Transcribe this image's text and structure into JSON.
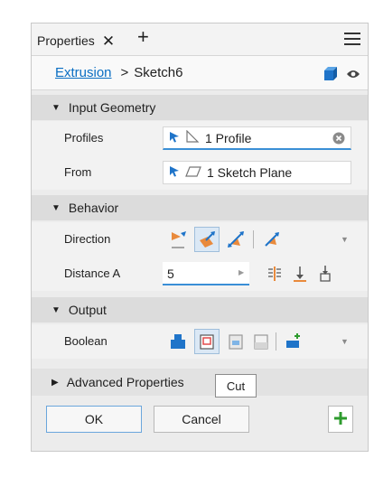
{
  "tab": {
    "title": "Properties"
  },
  "breadcrumb": {
    "parent": "Extrusion",
    "separator": ">",
    "current": "Sketch6"
  },
  "sections": {
    "input_geometry": {
      "title": "Input Geometry"
    },
    "behavior": {
      "title": "Behavior"
    },
    "output": {
      "title": "Output"
    },
    "advanced": {
      "title": "Advanced Properties"
    }
  },
  "input_geometry": {
    "profiles": {
      "label": "Profiles",
      "value": "1 Profile"
    },
    "from": {
      "label": "From",
      "value": "1 Sketch Plane"
    }
  },
  "behavior": {
    "direction": {
      "label": "Direction"
    },
    "distance_a": {
      "label": "Distance A",
      "value": "5"
    }
  },
  "output": {
    "boolean": {
      "label": "Boolean"
    }
  },
  "tooltip": {
    "text": "Cut"
  },
  "footer": {
    "ok_label": "OK",
    "cancel_label": "Cancel"
  },
  "colors": {
    "accent_blue": "#3a8fd6",
    "link_blue": "#0b6fc3",
    "orange": "#e98a3c",
    "green": "#2e9b2e"
  }
}
